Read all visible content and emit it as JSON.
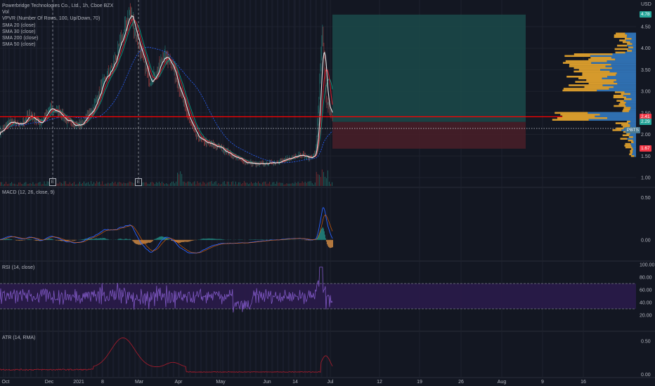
{
  "legend": {
    "title": "Powerbridge Technologies Co., Ltd., 1h, Cboe BZX",
    "items": [
      "Vol",
      "VPVR (Number Of Rows, 100, Up/Down, 70)",
      "SMA 20 (close)",
      "SMA 30 (close)",
      "SMA 200 (close)",
      "SMA 50 (close)"
    ]
  },
  "panes": {
    "macd": "MACD (12, 26, close, 9)",
    "rsi": "RSI (14, close)",
    "atr": "ATR (14, RMA)"
  },
  "price_axis": {
    "currency": "USD",
    "ticks": [
      "4.50",
      "4.00",
      "3.50",
      "3.00",
      "2.50",
      "2.00",
      "1.50",
      "1.00"
    ],
    "tags": [
      {
        "label": "4.78",
        "value": 4.78,
        "color": "#26a69a"
      },
      {
        "label": "2.41",
        "value": 2.41,
        "color": "#f23645"
      },
      {
        "label": "2.29",
        "value": 2.29,
        "color": "#26a69a"
      },
      {
        "label": "PBTS",
        "value": 2.1,
        "color": "#4a7a92"
      },
      {
        "label": "1.67",
        "value": 1.67,
        "color": "#f23645"
      }
    ]
  },
  "macd_axis": [
    "0.50",
    "0.00"
  ],
  "rsi_axis": [
    "100.00",
    "80.00",
    "60.00",
    "40.00",
    "20.00"
  ],
  "atr_axis": [
    "0.50",
    "0.00"
  ],
  "time_axis": [
    "Oct",
    "Dec",
    "2021",
    "8",
    "Mar",
    "Apr",
    "May",
    "Jun",
    "14",
    "Jul",
    "12",
    "19",
    "26",
    "Aug",
    "9",
    "16"
  ],
  "earnings_marker": "E",
  "colors": {
    "background": "#131722",
    "sma20": "#e8e8e8",
    "sma30": "#d01c2c",
    "sma200": "#2962ff",
    "sma50": "#089981",
    "resistance": "#ff0000",
    "profit_zone": "#1b4a4a",
    "loss_zone": "#4a1f28",
    "vpvr_up": "#2f6fb0",
    "vpvr_down": "#d69a2c",
    "macd_line": "#2962ff",
    "signal_line": "#ff6d00",
    "rsi_line": "#7e57c2",
    "atr_line": "#a01c2c"
  },
  "chart_data": {
    "type": "line",
    "symbol": "PBTS",
    "interval": "1h",
    "exchange": "Cboe BZX",
    "price_range": [
      0.9,
      4.85
    ],
    "price_series": [
      {
        "t": 0.0,
        "p": 2.05
      },
      {
        "t": 0.03,
        "p": 2.3
      },
      {
        "t": 0.06,
        "p": 2.2
      },
      {
        "t": 0.09,
        "p": 2.45
      },
      {
        "t": 0.12,
        "p": 2.25
      },
      {
        "t": 0.15,
        "p": 2.6
      },
      {
        "t": 0.18,
        "p": 2.5
      },
      {
        "t": 0.2,
        "p": 2.3
      },
      {
        "t": 0.24,
        "p": 2.2
      },
      {
        "t": 0.28,
        "p": 2.6
      },
      {
        "t": 0.31,
        "p": 3.2
      },
      {
        "t": 0.34,
        "p": 3.6
      },
      {
        "t": 0.37,
        "p": 4.3
      },
      {
        "t": 0.39,
        "p": 4.85
      },
      {
        "t": 0.41,
        "p": 4.3
      },
      {
        "t": 0.43,
        "p": 3.7
      },
      {
        "t": 0.45,
        "p": 3.25
      },
      {
        "t": 0.47,
        "p": 3.4
      },
      {
        "t": 0.49,
        "p": 3.8
      },
      {
        "t": 0.51,
        "p": 3.75
      },
      {
        "t": 0.53,
        "p": 3.3
      },
      {
        "t": 0.56,
        "p": 2.5
      },
      {
        "t": 0.59,
        "p": 1.95
      },
      {
        "t": 0.62,
        "p": 1.8
      },
      {
        "t": 0.66,
        "p": 1.7
      },
      {
        "t": 0.7,
        "p": 1.5
      },
      {
        "t": 0.74,
        "p": 1.35
      },
      {
        "t": 0.78,
        "p": 1.3
      },
      {
        "t": 0.82,
        "p": 1.35
      },
      {
        "t": 0.86,
        "p": 1.4
      },
      {
        "t": 0.9,
        "p": 1.55
      },
      {
        "t": 0.93,
        "p": 1.45
      },
      {
        "t": 0.95,
        "p": 1.55
      },
      {
        "t": 0.97,
        "p": 4.4
      },
      {
        "t": 0.98,
        "p": 2.8
      },
      {
        "t": 1.0,
        "p": 2.35
      }
    ],
    "resistance_level": 2.41,
    "dotted_level": 2.14,
    "position": {
      "entry": 2.29,
      "target": 4.78,
      "stop": 1.67
    },
    "rsi_levels": [
      70,
      30
    ],
    "rsi_range": [
      0,
      100
    ],
    "macd_range": [
      -0.25,
      0.62
    ],
    "atr_range": [
      -0.05,
      0.65
    ]
  }
}
